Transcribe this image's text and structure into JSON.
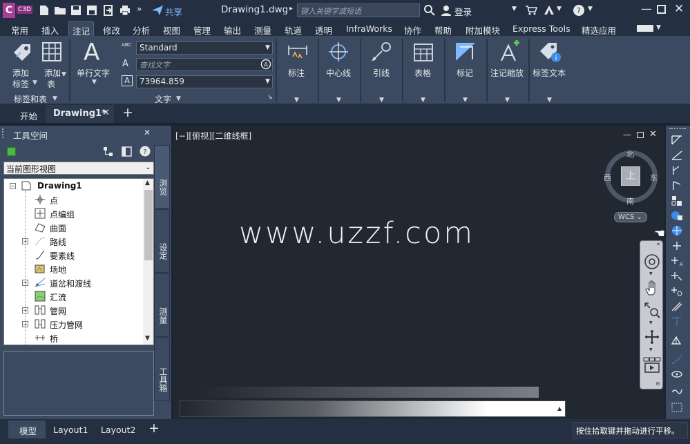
{
  "titlebar": {
    "app_badge": "C3D",
    "share_label": "共享",
    "document_title": "Drawing1.dwg",
    "search_placeholder": "键入关键字或短语",
    "login_label": "登录"
  },
  "menu_tabs": [
    "常用",
    "插入",
    "注记",
    "修改",
    "分析",
    "视图",
    "管理",
    "输出",
    "测量",
    "轨道",
    "透明",
    "InfraWorks",
    "协作",
    "帮助",
    "附加模块",
    "Express Tools",
    "精选应用"
  ],
  "active_menu_tab": "注记",
  "ribbon": {
    "add_label_1": "添加",
    "add_label_2": "标签",
    "add_table_1": "添加",
    "add_table_2": "表",
    "single_text": "单行文字",
    "style_combo": "Standard",
    "find_text_placeholder": "查找文字",
    "text_height": "73964.859",
    "abc_label": "ABC",
    "panel_labels_tables": "标签和表",
    "panel_text": "文字",
    "dimension": "标注",
    "centerline": "中心线",
    "leader": "引线",
    "table": "表格",
    "markup": "标记",
    "annotation_scale": "注记缩放",
    "tag_text": "标签文本"
  },
  "file_tabs": {
    "start": "开始",
    "drawing": "Drawing1*"
  },
  "toolspace": {
    "title": "工具空间",
    "view_select": "当前图形视图",
    "tree_root": "Drawing1",
    "tree_items": [
      "点",
      "点编组",
      "曲面",
      "路线",
      "要素线",
      "场地",
      "道岔和渡线",
      "汇流",
      "管网",
      "压力管网",
      "桥"
    ],
    "vertical_tabs": [
      "浏览",
      "设定",
      "测量",
      "工具箱"
    ]
  },
  "viewport": {
    "view_label": "[−][俯视][二维线框]",
    "watermark": "www.uzzf.com",
    "compass_n": "北",
    "compass_s": "南",
    "compass_e": "东",
    "compass_w": "西",
    "cube_face": "上",
    "wcs": "WCS"
  },
  "statusbar": {
    "model": "模型",
    "layout1": "Layout1",
    "layout2": "Layout2",
    "tip": "按住拾取键并拖动进行平移。"
  },
  "colors": {
    "accent": "#7fbaff",
    "ribbon_bg": "#3b4a60",
    "viewport_bg": "#212832"
  }
}
